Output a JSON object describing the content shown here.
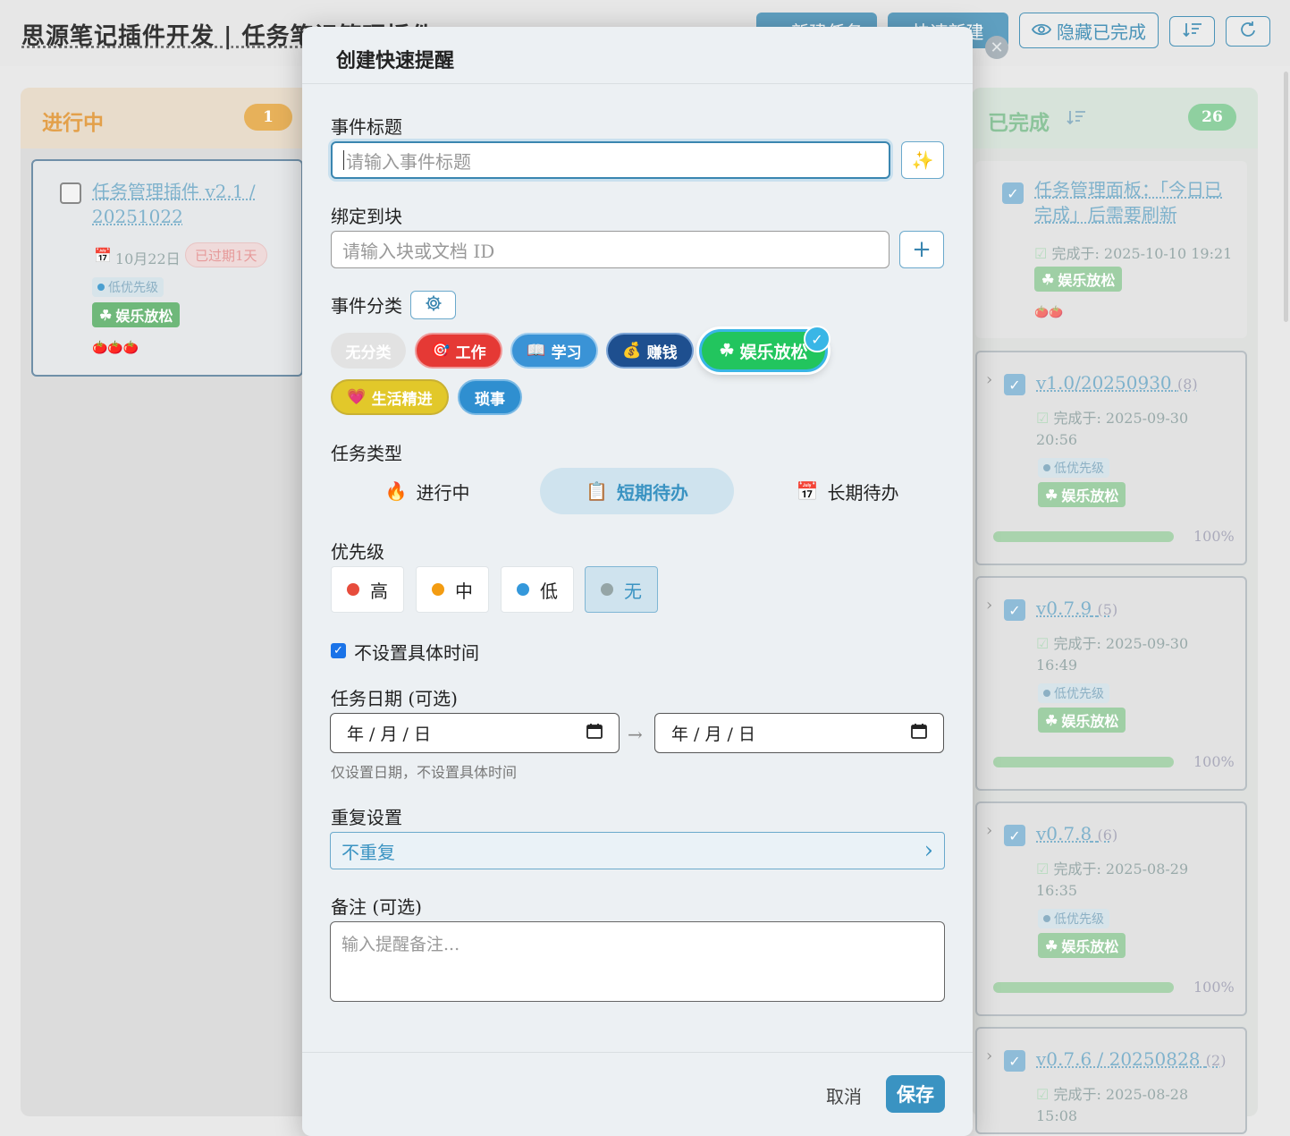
{
  "app": {
    "title": "思源笔记插件开发 | 任务笔记管理插件",
    "header_buttons": [
      {
        "label": "+ 新建任务"
      },
      {
        "label": "快速新建"
      },
      {
        "label": "隐藏已完成"
      }
    ]
  },
  "columns": {
    "doing": {
      "title": "进行中",
      "count": "1",
      "cards": [
        {
          "title": "任务管理插件 v2.1 / 20251022",
          "date": "10月22日",
          "overdue": "已过期1天",
          "priority": "低优先级",
          "category": "娱乐放松",
          "pomodoros": "🍅🍅🍅"
        }
      ]
    },
    "done": {
      "title": "已完成",
      "count": "26",
      "cards": [
        {
          "title": "任务管理面板：「今日已完成」后需要刷新",
          "completed": "完成于: 2025-10-10 19:21",
          "category": "娱乐放松",
          "pomodoros": "🍅🍅"
        },
        {
          "title": "v1.0/20250930",
          "sub": "(8)",
          "completed": "完成于: 2025-09-30 20:56",
          "priority": "低优先级",
          "category": "娱乐放松",
          "percent": "100%"
        },
        {
          "title": "v0.7.9",
          "sub": "(5)",
          "completed": "完成于: 2025-09-30 16:49",
          "priority": "低优先级",
          "category": "娱乐放松",
          "percent": "100%"
        },
        {
          "title": "v0.7.8",
          "sub": "(6)",
          "completed": "完成于: 2025-08-29 16:35",
          "priority": "低优先级",
          "category": "娱乐放松",
          "percent": "100%"
        },
        {
          "title": "v0.7.6 / 20250828",
          "sub": "(2)",
          "completed": "完成于: 2025-08-28 15:08"
        }
      ]
    }
  },
  "modal": {
    "title": "创建快速提醒",
    "event_title_label": "事件标题",
    "event_title_placeholder": "请输入事件标题",
    "bind_label": "绑定到块",
    "bind_placeholder": "请输入块或文档 ID",
    "category_label": "事件分类",
    "categories": [
      {
        "label": "无分类",
        "color": "#e2e2e2"
      },
      {
        "label": "工作",
        "color": "#e53935"
      },
      {
        "label": "学习",
        "color": "#3a93d6"
      },
      {
        "label": "赚钱",
        "color": "#1e4f8f"
      },
      {
        "label": "娱乐放松",
        "color": "#22c55e",
        "selected": true
      },
      {
        "label": "生活精进",
        "color": "#e2c82a"
      },
      {
        "label": "琐事",
        "color": "#2f8fd0"
      }
    ],
    "task_type_label": "任务类型",
    "task_types": [
      {
        "label": "进行中"
      },
      {
        "label": "短期待办",
        "selected": true
      },
      {
        "label": "长期待办"
      }
    ],
    "priority_label": "优先级",
    "priorities": [
      {
        "label": "高",
        "color": "#e74c3c"
      },
      {
        "label": "中",
        "color": "#f39c12"
      },
      {
        "label": "低",
        "color": "#3498db"
      },
      {
        "label": "无",
        "color": "#95a5a6",
        "selected": true
      }
    ],
    "no_time_label": "不设置具体时间",
    "no_time_checked": true,
    "date_label": "任务日期 (可选)",
    "date_start": "年 / 月 / 日",
    "date_end": "年 / 月 / 日",
    "date_hint": "仅设置日期，不设置具体时间",
    "repeat_label": "重复设置",
    "repeat_value": "不重复",
    "note_label": "备注 (可选)",
    "note_placeholder": "输入提醒备注...",
    "cancel": "取消",
    "save": "保存"
  },
  "colors": {
    "accent": "#3a93c2",
    "overlay_header": "#e7e7e7"
  }
}
